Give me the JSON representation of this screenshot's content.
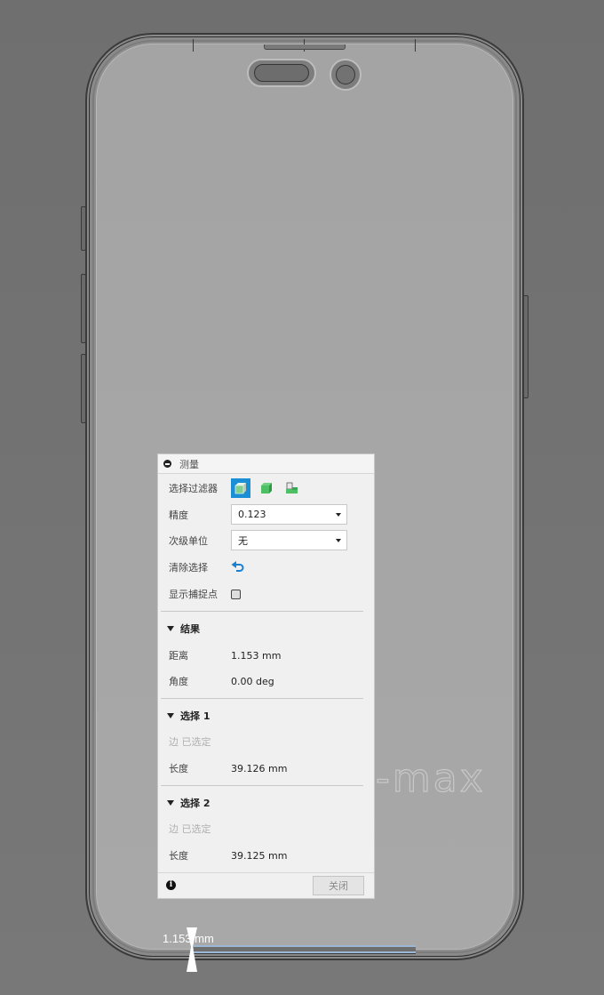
{
  "viewport": {
    "model_engraving": "-max",
    "dimension_label": "1.153 mm"
  },
  "panel": {
    "title": "测量",
    "rows": {
      "selection_filter": {
        "label": "选择过滤器",
        "filters": [
          "body-filter",
          "face-filter",
          "edge-filter"
        ],
        "active_filter": "body-filter"
      },
      "precision": {
        "label": "精度",
        "value": "0.123"
      },
      "secondary_unit": {
        "label": "次级单位",
        "value": "无"
      },
      "clear_selection": {
        "label": "清除选择"
      },
      "show_snap_points": {
        "label": "显示捕捉点",
        "checked": false
      }
    },
    "results": {
      "title": "结果",
      "distance_label": "距离",
      "distance_value": "1.153 mm",
      "angle_label": "角度",
      "angle_value": "0.00 deg"
    },
    "selection1": {
      "title": "选择 1",
      "status": "边 已选定",
      "length_label": "长度",
      "length_value": "39.126 mm"
    },
    "selection2": {
      "title": "选择 2",
      "status": "边 已选定",
      "length_label": "长度",
      "length_value": "39.125 mm"
    },
    "footer": {
      "close_label": "关闭"
    }
  },
  "colors": {
    "accent": "#1a8fd6",
    "filter_green": "#4fbf66",
    "measure_highlight": "#9cb7d6"
  }
}
